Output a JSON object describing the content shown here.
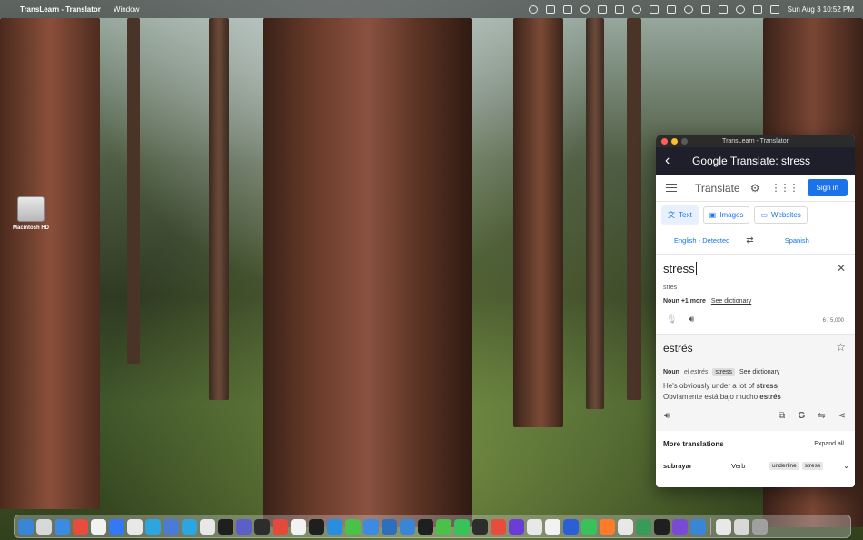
{
  "menubar": {
    "app_name": "TransLearn - Translator",
    "menus": [
      "Window"
    ],
    "clock": "Sun Aug 3  10:52 PM",
    "status_icons": [
      "search-icon",
      "notification-icon",
      "shield-icon",
      "download-icon",
      "record-icon",
      "screen-icon",
      "broadcast-icon",
      "app-icon",
      "lock-icon",
      "bluetooth-icon",
      "chat-icon",
      "wifi-icon",
      "battery-icon",
      "control-center-icon",
      "avatar-icon"
    ]
  },
  "desktop": {
    "hd_label": "Macintosh HD"
  },
  "window": {
    "title": "TransLearn - Translator",
    "header_title": "Google Translate: stress",
    "brand": "Translate",
    "signin": "Sign in",
    "modes": [
      {
        "label": "Text",
        "icon": "translate-icon"
      },
      {
        "label": "Images",
        "icon": "image-icon"
      },
      {
        "label": "Websites",
        "icon": "website-icon"
      }
    ],
    "source_lang": "English - Detected",
    "target_lang": "Spanish",
    "input": {
      "query": "stress",
      "transliteration": "stres",
      "pos_label": "Noun",
      "pos_more": "+1 more",
      "see_dictionary": "See dictionary",
      "char_count": "6 / 5,000"
    },
    "output": {
      "result": "estrés",
      "pos": "Noun",
      "article_form": "el estrés",
      "chip": "stress",
      "see_dictionary": "See dictionary",
      "example_en_pre": "He's obviously under a lot of ",
      "example_en_bold": "stress",
      "example_es_pre": "Obviamente está bajo mucho ",
      "example_es_bold": "estrés"
    },
    "more": {
      "title": "More translations",
      "expand": "Expand all",
      "rows": [
        {
          "word": "subrayar",
          "pos": "Verb",
          "chips": [
            "underline",
            "stress"
          ]
        }
      ]
    }
  },
  "dock": {
    "colors": [
      "#3a86d6",
      "#d8d8d8",
      "#3c8be0",
      "#e84c3c",
      "#f2f2f2",
      "#3478f6",
      "#e8e8e8",
      "#2ca5e0",
      "#4a7bd8",
      "#2ca5e0",
      "#e8e8e8",
      "#1f1f1f",
      "#5b5fc7",
      "#2d2d2d",
      "#e34a3a",
      "#f2f2f2",
      "#1f1f1f",
      "#2a8ee0",
      "#4ac24a",
      "#3c8be0",
      "#2d6fbd",
      "#3a86d6",
      "#1f1f1f",
      "#4ac24a",
      "#3ac25a",
      "#2d2d2d",
      "#e84c3c",
      "#6a3dd6",
      "#e8e8e8",
      "#f2f2f2",
      "#2a5fd6",
      "#3ac25a",
      "#ff7b2a",
      "#e8e8e8",
      "#3a9a5a",
      "#1f1f1f",
      "#7a4ad6",
      "#3a86d6",
      "#e8e8e8",
      "#d8d8d8",
      "#a0a0a0"
    ]
  }
}
